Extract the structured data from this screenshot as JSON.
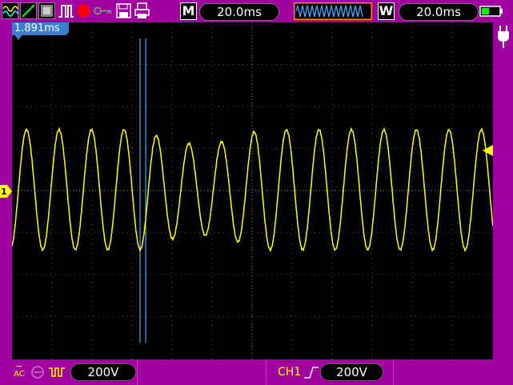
{
  "toolbar": {
    "icons": [
      "waveform-icon",
      "line-icon",
      "image-icon",
      "pulse-icon",
      "record-icon",
      "key-icon",
      "save-icon",
      "print-icon"
    ],
    "m_label": "M",
    "m_value": "20.0ms",
    "w_label": "W",
    "w_value": "20.0ms"
  },
  "screen": {
    "cursor_readout": "1.891ms",
    "channel_marker": "1"
  },
  "bottom": {
    "coupling": "AC",
    "volts_div": "200V",
    "trigger_channel": "CH1",
    "trigger_level": "200V"
  },
  "colors": {
    "frame": "#a000a0",
    "trace": "#ffff00",
    "cursor": "#4aa8ff",
    "grid": "#5a5a5a"
  }
}
